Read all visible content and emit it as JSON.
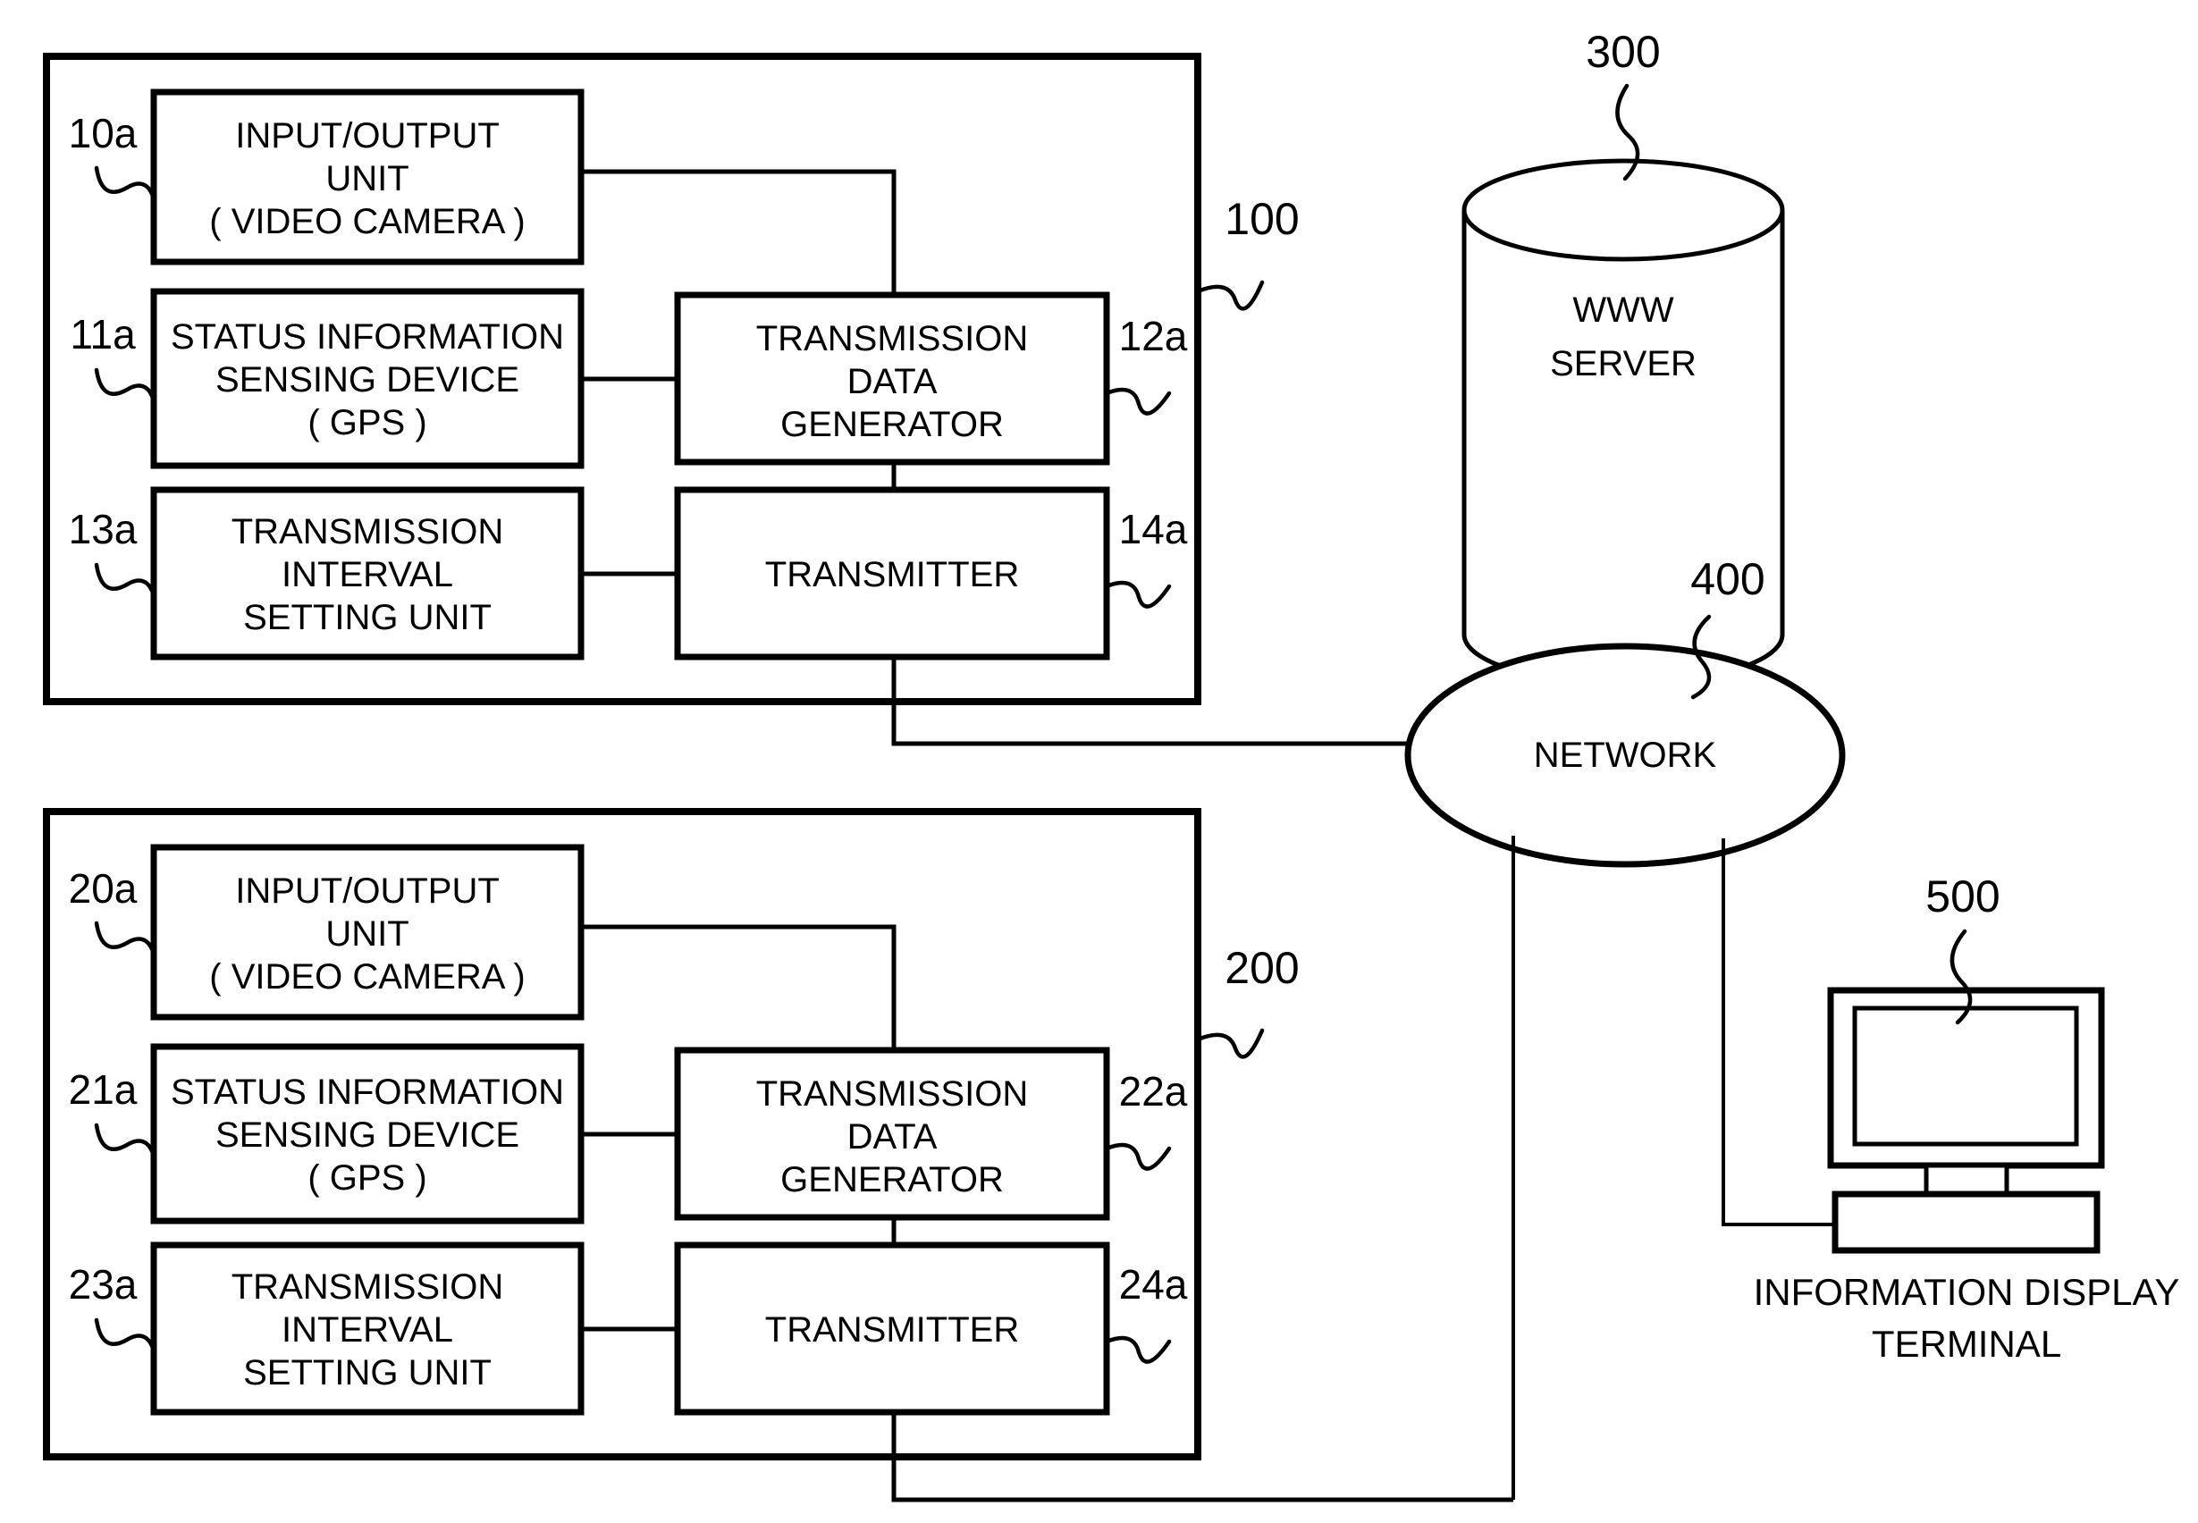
{
  "figure": {
    "systems": [
      {
        "ref": "100",
        "units": [
          {
            "ref": "10a",
            "lines": [
              "INPUT/OUTPUT",
              "UNIT",
              "( VIDEO CAMERA )"
            ]
          },
          {
            "ref": "11a",
            "lines": [
              "STATUS INFORMATION",
              "SENSING DEVICE",
              "( GPS )"
            ]
          },
          {
            "ref": "13a",
            "lines": [
              "TRANSMISSION",
              "INTERVAL",
              "SETTING UNIT"
            ]
          },
          {
            "ref": "12a",
            "lines": [
              "TRANSMISSION",
              "DATA",
              "GENERATOR"
            ]
          },
          {
            "ref": "14a",
            "lines": [
              "TRANSMITTER"
            ]
          }
        ]
      },
      {
        "ref": "200",
        "units": [
          {
            "ref": "20a",
            "lines": [
              "INPUT/OUTPUT",
              "UNIT",
              "( VIDEO CAMERA )"
            ]
          },
          {
            "ref": "21a",
            "lines": [
              "STATUS INFORMATION",
              "SENSING DEVICE",
              "( GPS )"
            ]
          },
          {
            "ref": "23a",
            "lines": [
              "TRANSMISSION",
              "INTERVAL",
              "SETTING UNIT"
            ]
          },
          {
            "ref": "22a",
            "lines": [
              "TRANSMISSION",
              "DATA",
              "GENERATOR"
            ]
          },
          {
            "ref": "24a",
            "lines": [
              "TRANSMITTER"
            ]
          }
        ]
      }
    ],
    "nodes": {
      "server": {
        "ref": "300",
        "lines": [
          "WWW",
          "SERVER"
        ]
      },
      "network": {
        "ref": "400",
        "label": "NETWORK"
      },
      "terminal": {
        "ref": "500",
        "caption": [
          "INFORMATION DISPLAY",
          "TERMINAL"
        ]
      }
    },
    "colors": {
      "ink": "#000000",
      "paper": "#ffffff"
    }
  }
}
